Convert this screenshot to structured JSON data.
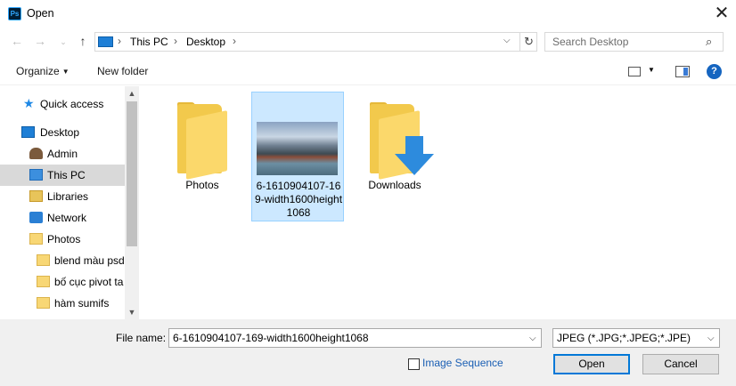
{
  "window": {
    "title": "Open",
    "app_icon": "Ps"
  },
  "address": {
    "crumbs": [
      "This PC",
      "Desktop"
    ]
  },
  "search": {
    "placeholder": "Search Desktop"
  },
  "toolbar": {
    "organize": "Organize",
    "new_folder": "New folder"
  },
  "sidebar": {
    "items": [
      {
        "label": "Quick access",
        "icon": "star-icon"
      },
      {
        "label": "Desktop",
        "icon": "desktop-icon"
      },
      {
        "label": "Admin",
        "icon": "user-icon"
      },
      {
        "label": "This PC",
        "icon": "pc-icon",
        "selected": true
      },
      {
        "label": "Libraries",
        "icon": "libraries-icon"
      },
      {
        "label": "Network",
        "icon": "network-icon"
      },
      {
        "label": "Photos",
        "icon": "folder-icon"
      },
      {
        "label": "blend màu psd",
        "icon": "folder-icon"
      },
      {
        "label": "bố cục pivot ta",
        "icon": "folder-icon"
      },
      {
        "label": "hàm sumifs",
        "icon": "folder-icon"
      }
    ]
  },
  "files": [
    {
      "name": "Photos",
      "kind": "folder"
    },
    {
      "name": "6-1610904107-169-width1600height1068",
      "kind": "image",
      "selected": true
    },
    {
      "name": "Downloads",
      "kind": "downloads-folder"
    }
  ],
  "footer": {
    "file_name_label": "File name:",
    "file_name_value": "6-1610904107-169-width1600height1068",
    "file_type_value": "JPEG (*.JPG;*.JPEG;*.JPE)",
    "image_sequence_label": "Image Sequence",
    "image_sequence_checked": false,
    "open_label": "Open",
    "cancel_label": "Cancel"
  }
}
